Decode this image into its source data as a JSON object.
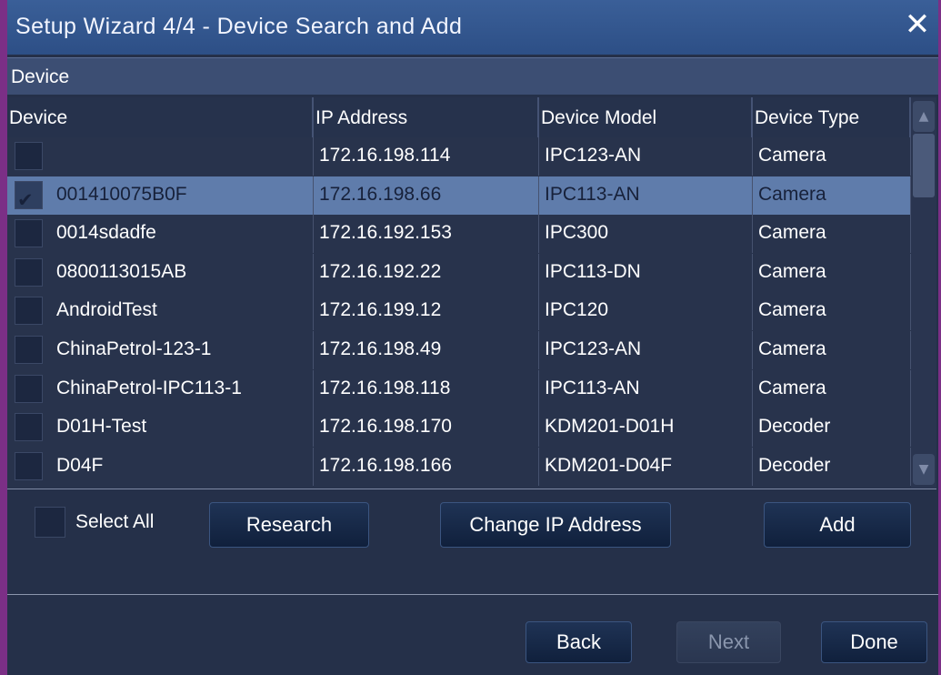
{
  "window": {
    "title": "Setup Wizard 4/4 - Device Search and Add",
    "close_label": "✕"
  },
  "section": {
    "label": "Device"
  },
  "table": {
    "columns": [
      "Device",
      "IP Address",
      "Device Model",
      "Device Type"
    ],
    "rows": [
      {
        "device": "",
        "ip": "172.16.198.114",
        "model": "IPC123-AN",
        "type": "Camera",
        "checked": false
      },
      {
        "device": "001410075B0F",
        "ip": "172.16.198.66",
        "model": "IPC113-AN",
        "type": "Camera",
        "checked": true
      },
      {
        "device": "0014sdadfe",
        "ip": "172.16.192.153",
        "model": "IPC300",
        "type": "Camera",
        "checked": false
      },
      {
        "device": "0800113015AB",
        "ip": "172.16.192.22",
        "model": "IPC113-DN",
        "type": "Camera",
        "checked": false
      },
      {
        "device": "AndroidTest",
        "ip": "172.16.199.12",
        "model": "IPC120",
        "type": "Camera",
        "checked": false
      },
      {
        "device": "ChinaPetrol-123-1",
        "ip": "172.16.198.49",
        "model": "IPC123-AN",
        "type": "Camera",
        "checked": false
      },
      {
        "device": "ChinaPetrol-IPC113-1",
        "ip": "172.16.198.118",
        "model": "IPC113-AN",
        "type": "Camera",
        "checked": false
      },
      {
        "device": "D01H-Test",
        "ip": "172.16.198.170",
        "model": "KDM201-D01H",
        "type": "Decoder",
        "checked": false
      },
      {
        "device": "D04F",
        "ip": "172.16.198.166",
        "model": "KDM201-D04F",
        "type": "Decoder",
        "checked": false
      }
    ],
    "selected_row": 1
  },
  "controls": {
    "select_all_label": "Select All",
    "research_label": "Research",
    "change_ip_label": "Change IP Address",
    "add_label": "Add"
  },
  "footer": {
    "back_label": "Back",
    "next_label": "Next",
    "done_label": "Done"
  },
  "icons": {
    "check": "check-icon",
    "close": "close-icon",
    "scroll_up": "chevron-up-icon",
    "scroll_down": "chevron-down-icon"
  },
  "colors": {
    "titlebar": "#2d4f86",
    "background": "#253049",
    "selected_row": "#5f7cab",
    "check": "#32d457"
  }
}
